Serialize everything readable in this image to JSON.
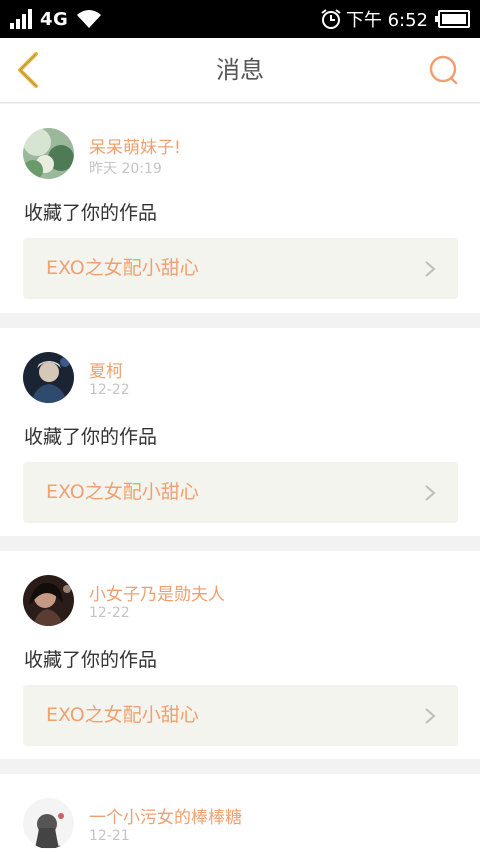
{
  "status": {
    "network": "4G",
    "time": "下午 6:52"
  },
  "nav": {
    "title": "消息"
  },
  "messages": [
    {
      "name": "呆呆萌妹子!",
      "date": "昨天 20:19",
      "action": "收藏了你的作品",
      "work": "EXO之女配小甜心"
    },
    {
      "name": "夏柯",
      "date": "12-22",
      "action": "收藏了你的作品",
      "work": "EXO之女配小甜心"
    },
    {
      "name": "小女子乃是勋夫人",
      "date": "12-22",
      "action": "收藏了你的作品",
      "work": "EXO之女配小甜心"
    },
    {
      "name": "一个小污女的棒棒糖",
      "date": "12-21"
    }
  ],
  "colors": {
    "accent": "#f0a070",
    "back_arrow": "#e8b840"
  }
}
